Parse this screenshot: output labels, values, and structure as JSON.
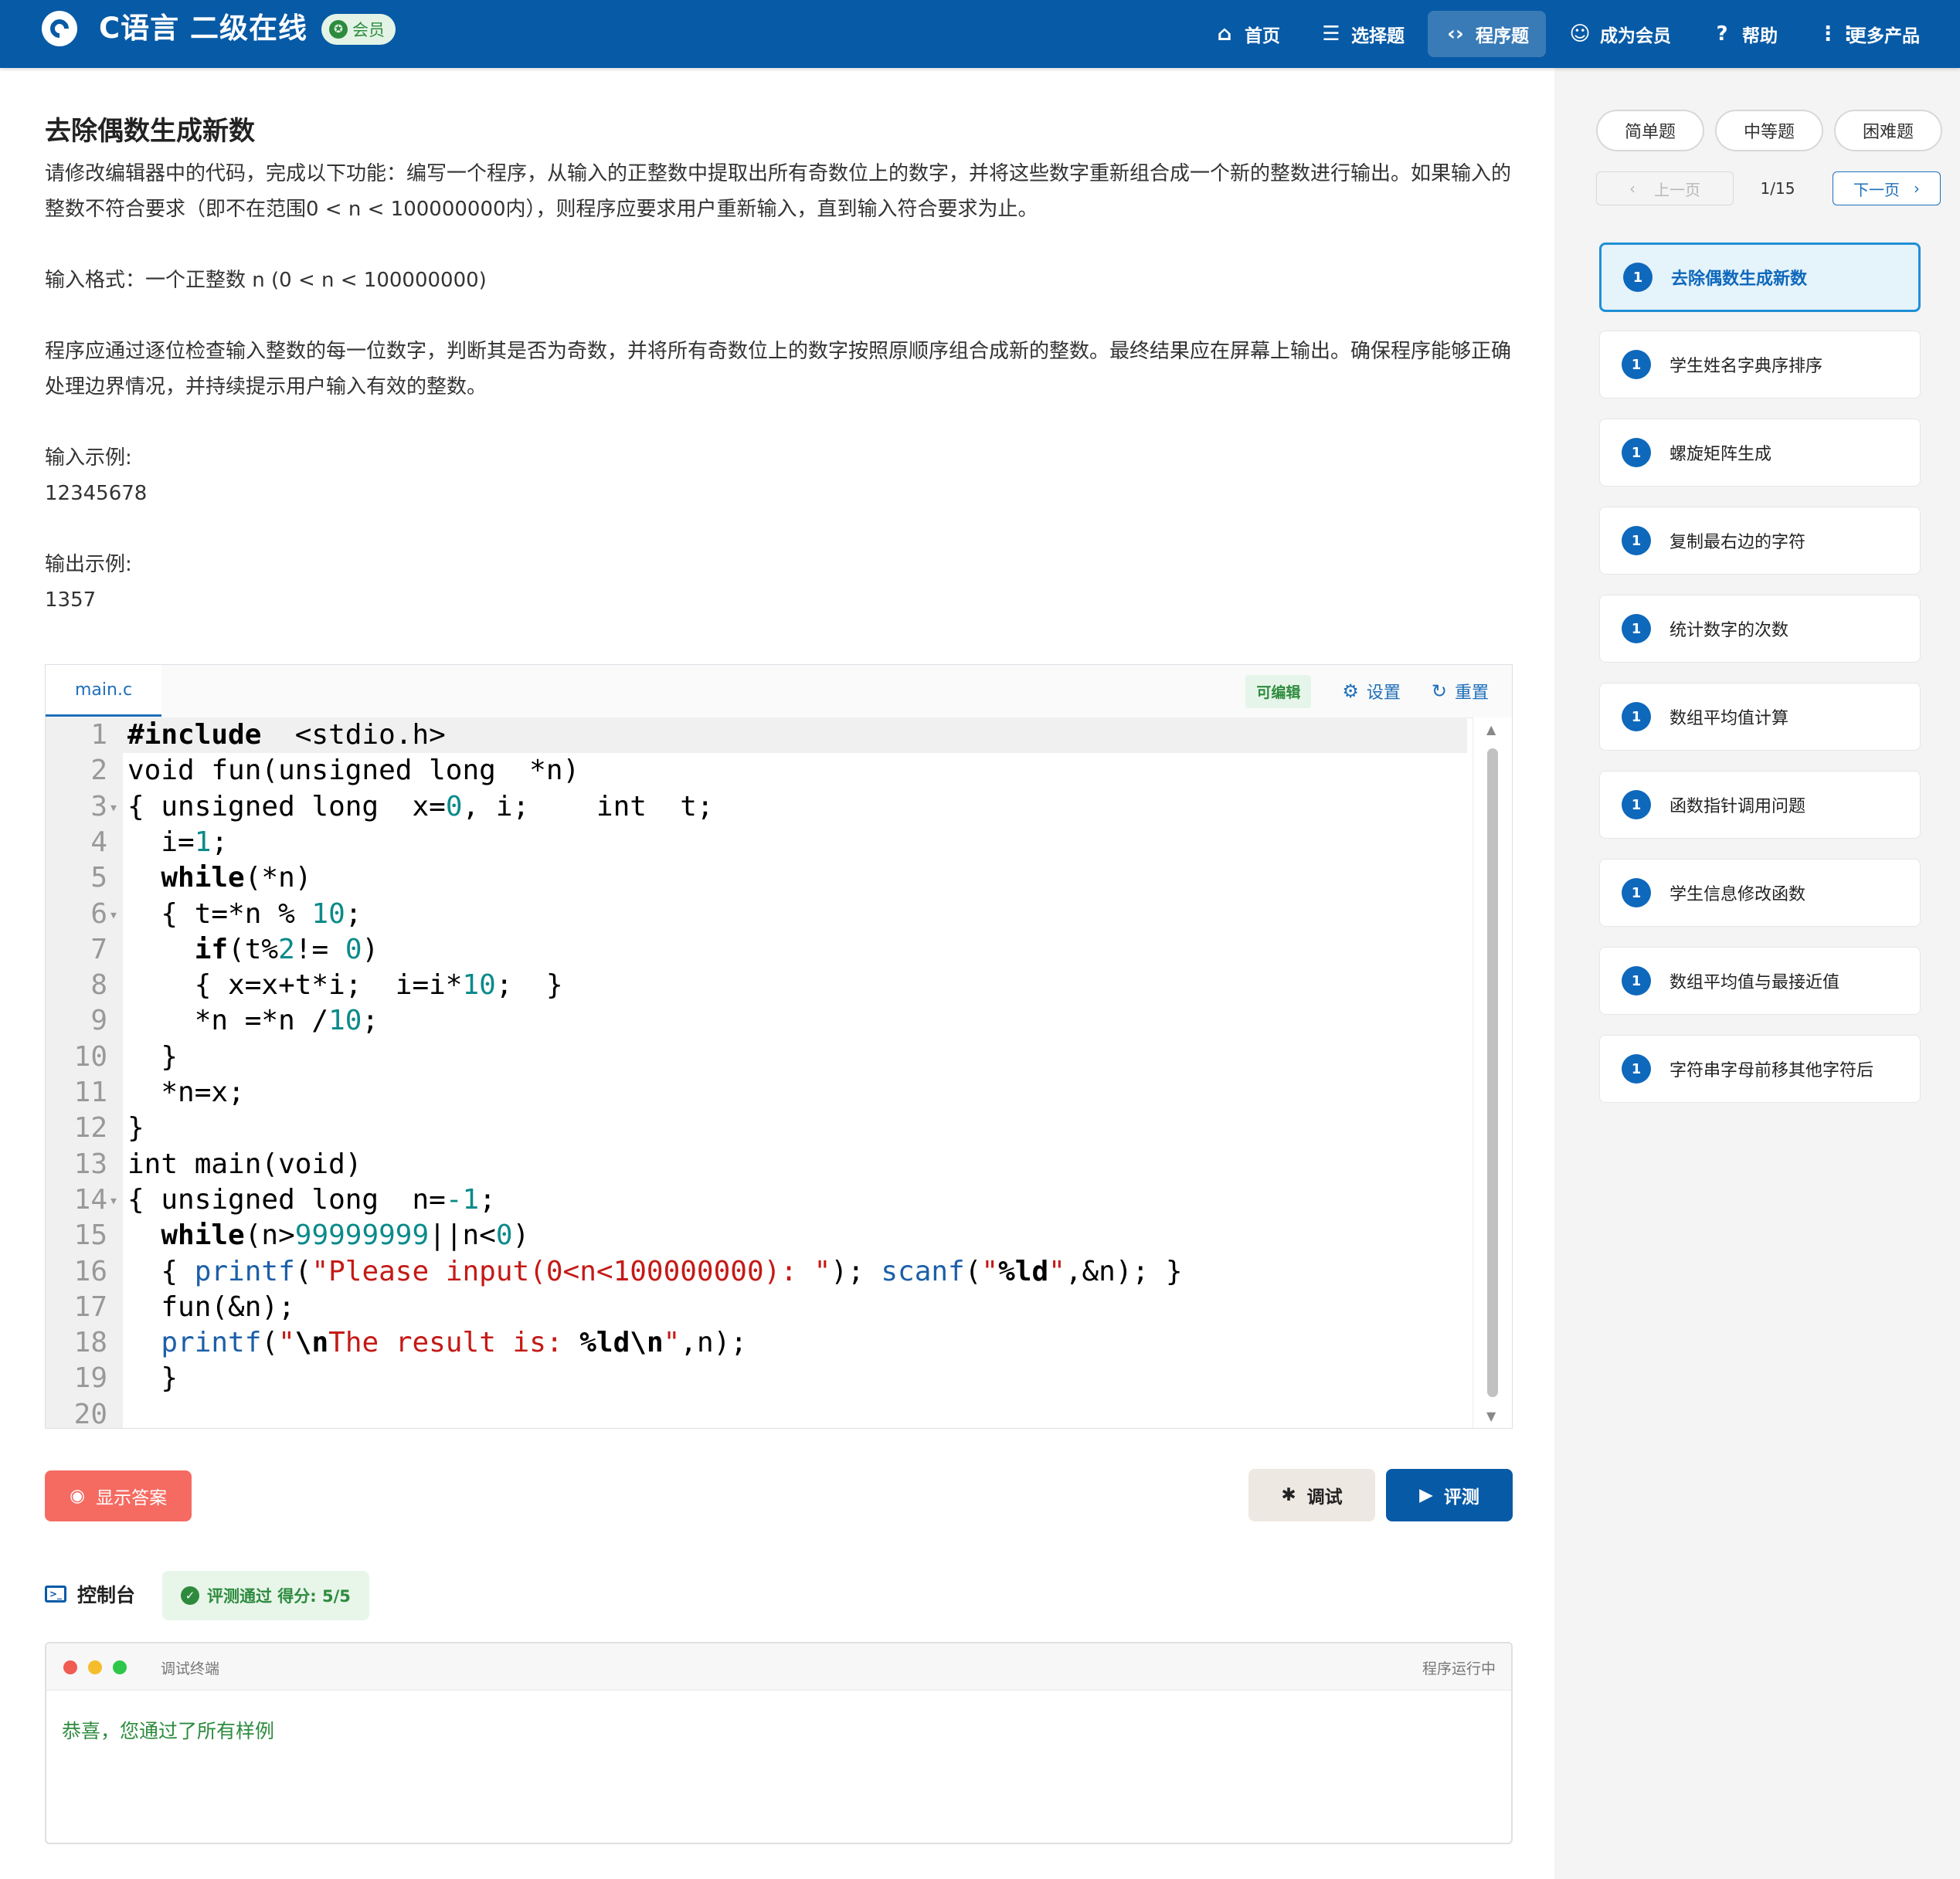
{
  "header": {
    "app_title": "C语言 二级在线",
    "member_badge": "会员",
    "nav": [
      {
        "label": "首页",
        "icon": "home-icon",
        "active": false
      },
      {
        "label": "选择题",
        "icon": "list-icon",
        "active": false
      },
      {
        "label": "程序题",
        "icon": "code-icon",
        "active": true
      },
      {
        "label": "成为会员",
        "icon": "user-add-icon",
        "active": false
      },
      {
        "label": "帮助",
        "icon": "help-icon",
        "active": false
      },
      {
        "label": "更多产品",
        "icon": "grid-icon",
        "active": false
      }
    ]
  },
  "problem": {
    "title": "去除偶数生成新数",
    "paragraphs": [
      "请修改编辑器中的代码，完成以下功能：编写一个程序，从输入的正整数中提取出所有奇数位上的数字，并将这些数字重新组合成一个新的整数进行输出。如果输入的整数不符合要求（即不在范围0 < n < 100000000内），则程序应要求用户重新输入，直到输入符合要求为止。",
      "输入格式：一个正整数 n (0 < n < 100000000)",
      "程序应通过逐位检查输入整数的每一位数字，判断其是否为奇数，并将所有奇数位上的数字按照原顺序组合成新的整数。最终结果应在屏幕上输出。确保程序能够正确处理边界情况，并持续提示用户输入有效的整数。"
    ],
    "input_example_label": "输入示例:",
    "input_example": "12345678",
    "output_example_label": "输出示例:",
    "output_example": "1357"
  },
  "editor": {
    "file_tab": "main.c",
    "editable_tag": "可编辑",
    "settings_label": "设置",
    "reset_label": "重置",
    "lines": [
      "#include  <stdio.h>",
      "void fun(unsigned long  *n)",
      "{ unsigned long  x=0, i;    int  t;",
      "  i=1;",
      "  while(*n)",
      "  { t=*n % 10;",
      "    if(t%2!= 0)",
      "    { x=x+t*i;  i=i*10;  }",
      "    *n =*n /10;",
      "  }",
      "  *n=x;",
      "}",
      "int main(void)",
      "{ unsigned long  n=-1;",
      "  while(n>99999999||n<0)",
      "  { printf(\"Please input(0<n<100000000): \"); scanf(\"%ld\",&n); }",
      "  fun(&n);",
      "  printf(\"\\nThe result is: %ld\\n\",n);",
      "  }",
      ""
    ],
    "fold_lines": [
      3,
      6,
      14
    ]
  },
  "actions": {
    "show_answer": "显示答案",
    "debug": "调试",
    "evaluate": "评测"
  },
  "console": {
    "label": "控制台",
    "result": "评测通过 得分: 5/5",
    "terminal_title": "调试终端",
    "terminal_status": "程序运行中",
    "output": "恭喜，您通过了所有样例"
  },
  "sidebar": {
    "levels": [
      "简单题",
      "中等题",
      "困难题"
    ],
    "prev": "上一页",
    "page": "1/15",
    "next": "下一页",
    "questions": [
      {
        "num": "1",
        "label": "去除偶数生成新数",
        "active": true
      },
      {
        "num": "1",
        "label": "学生姓名字典序排序",
        "active": false
      },
      {
        "num": "1",
        "label": "螺旋矩阵生成",
        "active": false
      },
      {
        "num": "1",
        "label": "复制最右边的字符",
        "active": false
      },
      {
        "num": "1",
        "label": "统计数字的次数",
        "active": false
      },
      {
        "num": "1",
        "label": "数组平均值计算",
        "active": false
      },
      {
        "num": "1",
        "label": "函数指针调用问题",
        "active": false
      },
      {
        "num": "1",
        "label": "学生信息修改函数",
        "active": false
      },
      {
        "num": "1",
        "label": "数组平均值与最接近值",
        "active": false
      },
      {
        "num": "1",
        "label": "字符串字母前移其他字符后",
        "active": false
      }
    ]
  },
  "colors": {
    "brand": "#075aa6",
    "answer_button": "#f56b62",
    "success": "#2e8b3e"
  }
}
